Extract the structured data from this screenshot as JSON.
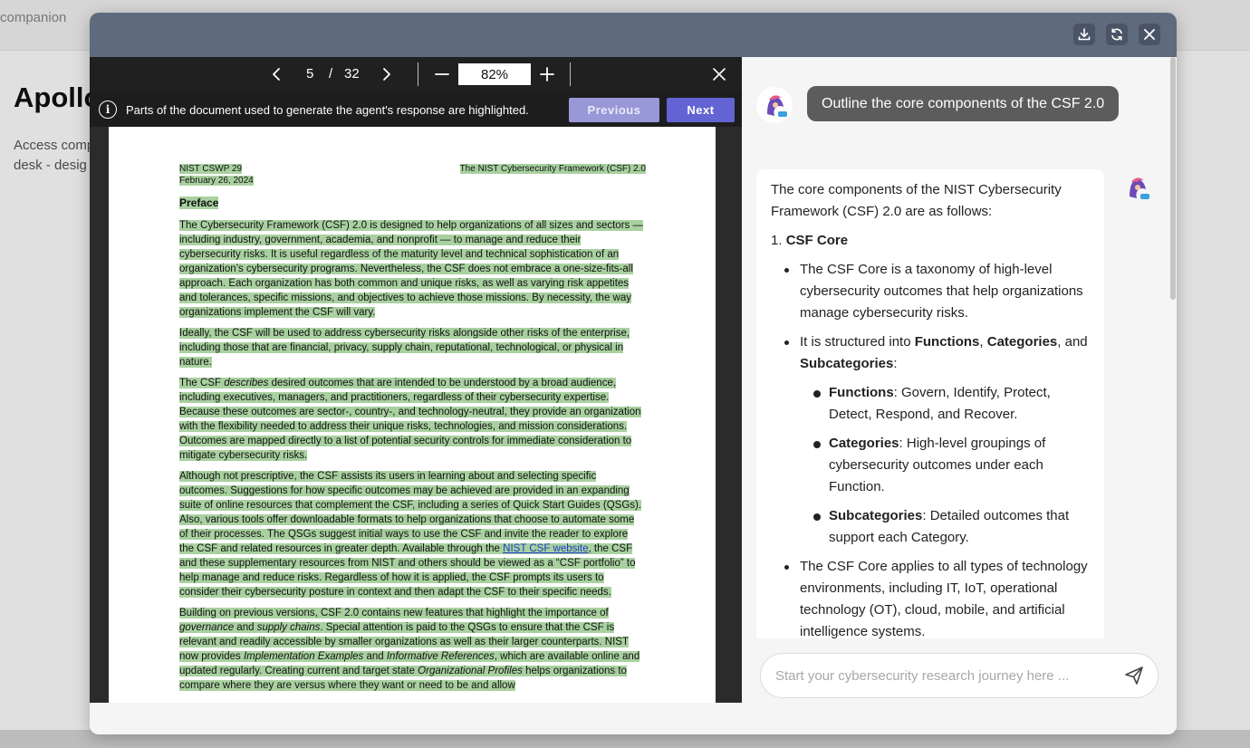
{
  "background": {
    "app_logo_sub": "companion",
    "page_title": "Apollo",
    "description": "Access comp desk - desig"
  },
  "modal": {
    "header_buttons": [
      {
        "name": "download",
        "icon": "download-icon"
      },
      {
        "name": "refresh",
        "icon": "refresh-icon"
      },
      {
        "name": "close",
        "icon": "close-icon"
      }
    ]
  },
  "viewer": {
    "current_page": "5",
    "page_separator": "/",
    "total_pages": "32",
    "zoom": "82%",
    "info_text": "Parts of the document used to generate the agent's response are highlighted.",
    "previous_label": "Previous",
    "next_label": "Next",
    "document": {
      "header_left_1": "NIST CSWP 29",
      "header_left_2": "February 26, 2024",
      "header_right": "The NIST Cybersecurity Framework (CSF) 2.0",
      "heading": "Preface",
      "p1": "The Cybersecurity Framework (CSF) 2.0 is designed to help organizations of all sizes and sectors — including industry, government, academia, and nonprofit — to manage and reduce their cybersecurity risks. It is useful regardless of the maturity level and technical sophistication of an organization’s cybersecurity programs. Nevertheless, the CSF does not embrace a one-size-fits-all approach. Each organization has both common and unique risks, as well as varying risk appetites and tolerances, specific missions, and objectives to achieve those missions. By necessity, the way organizations implement the CSF will vary.",
      "p2": "Ideally, the CSF will be used to address cybersecurity risks alongside other risks of the enterprise, including those that are financial, privacy, supply chain, reputational, technological, or physical in nature.",
      "p3_a": "The CSF ",
      "p3_em": "describes",
      "p3_b": " desired outcomes that are intended to be understood by a broad audience, including executives, managers, and practitioners, regardless of their cybersecurity expertise. Because these outcomes are sector-, country-, and technology-neutral, they provide an organization with the flexibility needed to address their unique risks, technologies, and mission considerations. Outcomes are mapped directly to a list of potential security controls for immediate consideration to mitigate cybersecurity risks.",
      "p4_a": "Although not prescriptive, the CSF assists its users in learning about and selecting specific outcomes. Suggestions for how specific outcomes may be achieved are provided in an expanding suite of online resources that complement the CSF, including a series of Quick Start Guides (QSGs). Also, various tools offer downloadable formats to help organizations that choose to automate some of their processes. The QSGs suggest initial ways to use the CSF and invite the reader to explore the CSF and related resources in greater depth. Available through the ",
      "p4_link": "NIST CSF website",
      "p4_b": ", the CSF and these supplementary resources from NIST and others should be viewed as a “CSF portfolio” to help manage and reduce risks. Regardless of how it is applied, the CSF prompts its users to consider their cybersecurity posture in context and then adapt the CSF to their specific needs.",
      "p5_a": "Building on previous versions, CSF 2.0 contains new features that highlight the importance of ",
      "p5_em1": "governance",
      "p5_b": " and ",
      "p5_em2": "supply chains",
      "p5_c": ". Special attention is paid to the QSGs to ensure that the CSF is relevant and readily accessible by smaller organizations as well as their larger counterparts. NIST now provides ",
      "p5_em3": "Implementation Examples",
      "p5_d": " and ",
      "p5_em4": "Informative References",
      "p5_e": ", which are available online and updated regularly. Creating current and target state ",
      "p5_em5": "Organizational Profiles",
      "p5_f": " helps organizations to compare where they are versus where they want or need to be and allow"
    }
  },
  "chat": {
    "user_message": "Outline the core components of the CSF 2.0",
    "response": {
      "intro": "The core components of the NIST Cybersecurity Framework (CSF) 2.0 are as follows:",
      "section_number": "1.",
      "section_title": "CSF Core",
      "bullet1": "The CSF Core is a taxonomy of high-level cybersecurity outcomes that help organizations manage cybersecurity risks.",
      "bullet2_a": "It is structured into ",
      "bullet2_functions": "Functions",
      "bullet2_comma": ", ",
      "bullet2_categories": "Categories",
      "bullet2_and": ", and ",
      "bullet2_subcategories": "Subcategories",
      "bullet2_colon": ":",
      "sub1_title": "Functions",
      "sub1_text": ": Govern, Identify, Protect, Detect, Respond, and Recover.",
      "sub2_title": "Categories",
      "sub2_text": ": High-level groupings of cybersecurity outcomes under each Function.",
      "sub3_title": "Subcategories",
      "sub3_text": ": Detailed outcomes that support each Category.",
      "bullet3": "The CSF Core applies to all types of technology environments, including IT, IoT, operational technology (OT), cloud, mobile, and artificial intelligence systems."
    },
    "input_placeholder": "Start your cybersecurity research journey here ...",
    "input_value": ""
  },
  "colors": {
    "modal_header": "#5f6a7d",
    "highlight": "#a9d1a0",
    "next_button": "#6363d4",
    "previous_button": "#9898d8",
    "user_bubble": "#5c5c5c"
  }
}
